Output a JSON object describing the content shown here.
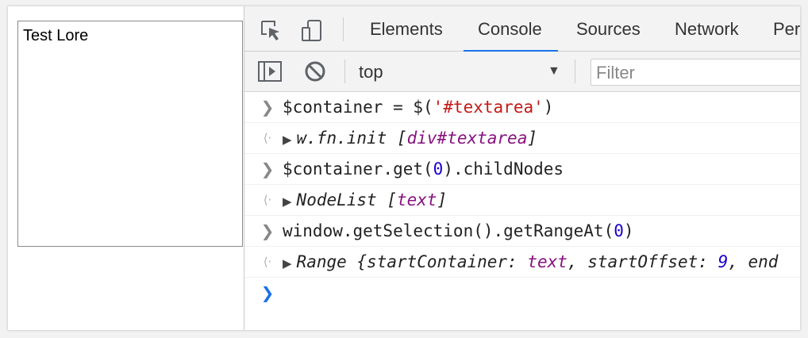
{
  "page": {
    "textarea_text": "Test Lore"
  },
  "devtools": {
    "tabs": [
      "Elements",
      "Console",
      "Sources",
      "Network",
      "Per"
    ],
    "active_tab": "Console",
    "toolbar": {
      "context": "top",
      "filter_placeholder": "Filter"
    },
    "console": [
      {
        "kind": "input",
        "parts": [
          "$container",
          " = ",
          "$(",
          "'#textarea'",
          ")"
        ]
      },
      {
        "kind": "output",
        "parts": [
          "w.fn.init [",
          "div#textarea",
          "]"
        ]
      },
      {
        "kind": "input",
        "parts": [
          "$container.get(",
          "0",
          ").childNodes"
        ]
      },
      {
        "kind": "output",
        "parts": [
          "NodeList [",
          "text",
          "]"
        ]
      },
      {
        "kind": "input",
        "parts": [
          "window.getSelection().getRangeAt(",
          "0",
          ")"
        ]
      },
      {
        "kind": "output",
        "parts": [
          "Range {startContainer: ",
          "text",
          ", startOffset: ",
          "9",
          ", end"
        ]
      }
    ],
    "colors": {
      "accent": "#1a73e8",
      "string": "#c41a16",
      "number": "#1c00cf",
      "keyword": "#881280"
    }
  }
}
